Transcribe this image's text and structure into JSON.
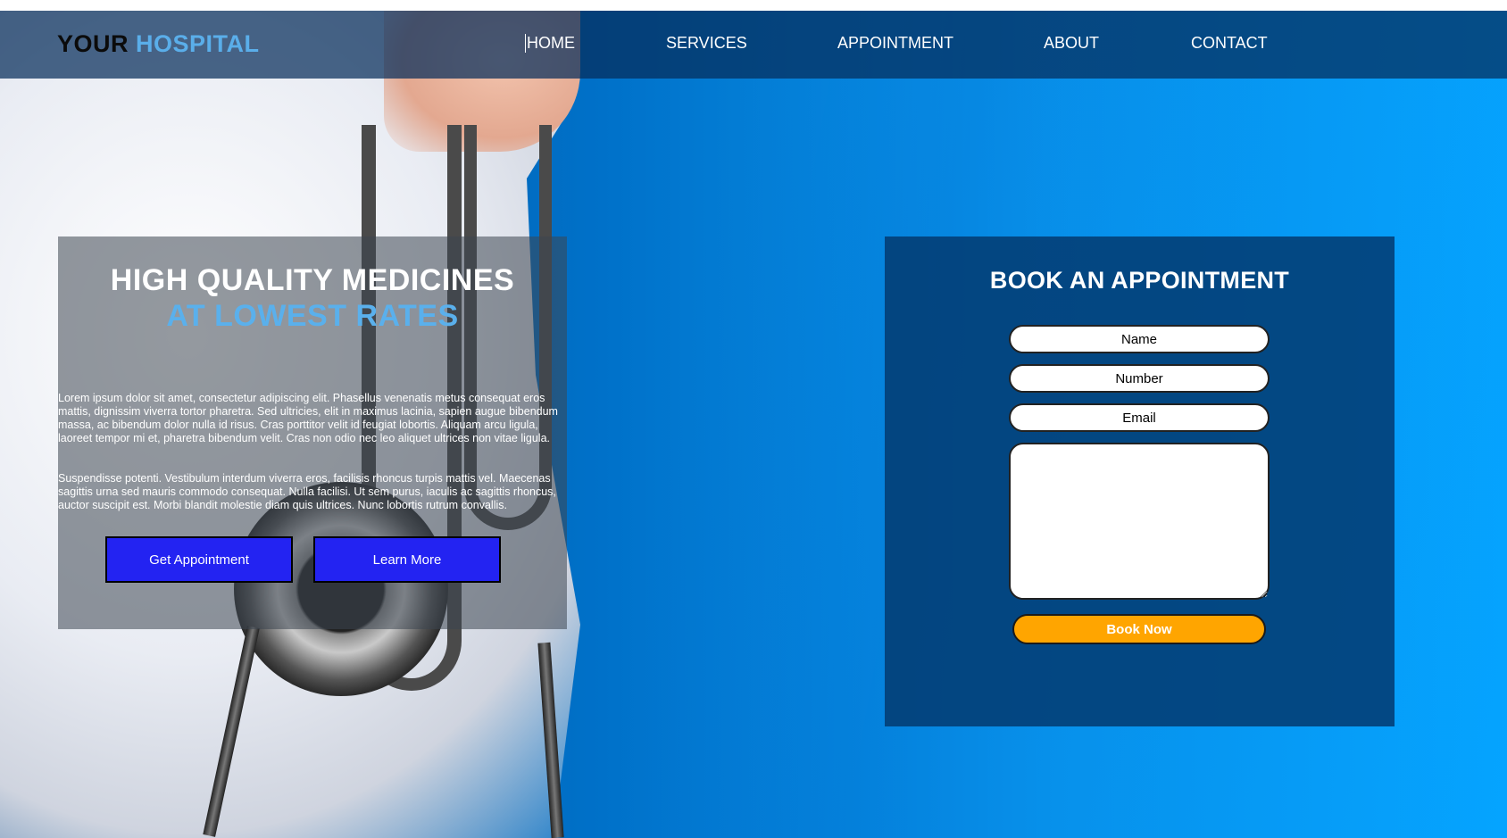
{
  "logo": {
    "part1": "YOUR",
    "part2": "HOSPITAL"
  },
  "nav": {
    "items": [
      {
        "label": "HOME",
        "active": true
      },
      {
        "label": "SERVICES"
      },
      {
        "label": "APPOINTMENT"
      },
      {
        "label": "ABOUT"
      },
      {
        "label": "CONTACT"
      }
    ]
  },
  "hero": {
    "title_line1": "HIGH QUALITY MEDICINES",
    "title_line2": "AT LOWEST RATES",
    "paragraph1": "Lorem ipsum dolor sit amet, consectetur adipiscing elit. Phasellus venenatis metus consequat eros mattis, dignissim viverra tortor pharetra. Sed ultricies, elit in maximus lacinia, sapien augue bibendum massa, ac bibendum dolor nulla id risus. Cras porttitor velit id feugiat lobortis. Aliquam arcu ligula, laoreet tempor mi et, pharetra bibendum velit. Cras non odio nec leo aliquet ultrices non vitae ligula.",
    "paragraph2": "Suspendisse potenti. Vestibulum interdum viverra eros, facilisis rhoncus turpis mattis vel. Maecenas sagittis urna sed mauris commodo consequat. Nulla facilisi. Ut sem purus, iaculis ac sagittis rhoncus, auctor suscipit est. Morbi blandit molestie diam quis ultrices. Nunc lobortis rutrum convallis.",
    "button_appointment": "Get Appointment",
    "button_learn": "Learn More"
  },
  "appointment_form": {
    "title": "BOOK AN APPOINTMENT",
    "name_placeholder": "Name",
    "number_placeholder": "Number",
    "email_placeholder": "Email",
    "message_value": "",
    "submit_label": "Book Now"
  },
  "colors": {
    "accent_blue": "#5aaeea",
    "button_blue": "#2323f2",
    "book_button": "#ffa500",
    "form_bg": "#033c73"
  }
}
